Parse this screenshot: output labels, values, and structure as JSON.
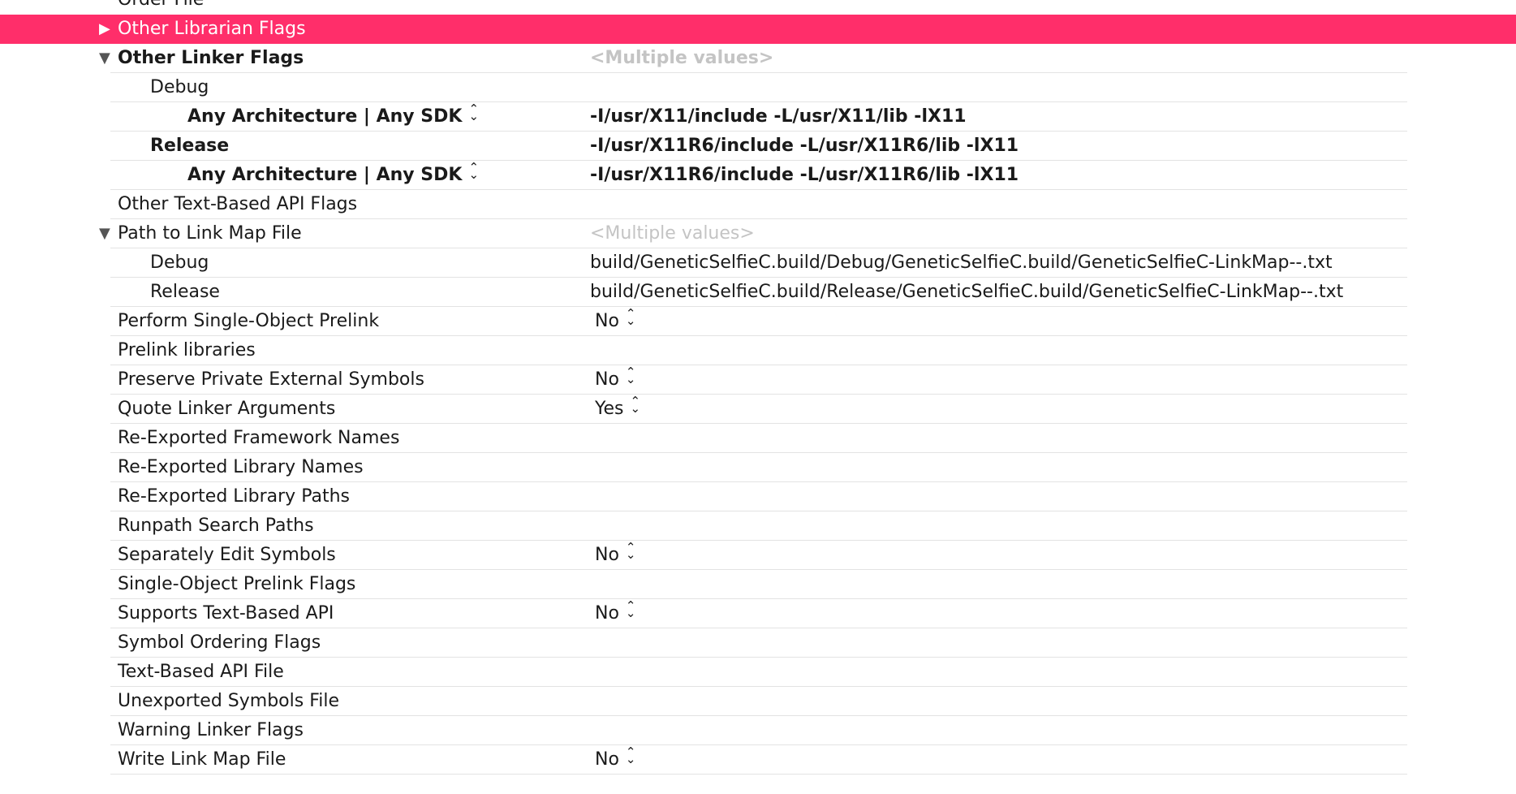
{
  "rows": [
    {
      "label": "Order File",
      "value": ""
    },
    {
      "label": "Other Librarian Flags",
      "value": "",
      "disclosure": "▶"
    },
    {
      "label": "Other Linker Flags",
      "value": "<Multiple values>",
      "disclosure": "▼"
    },
    {
      "label": "Debug",
      "value": ""
    },
    {
      "label": "Any Architecture | Any SDK",
      "value": "-I/usr/X11/include -L/usr/X11/lib -lX11"
    },
    {
      "label": "Release",
      "value": "-I/usr/X11R6/include -L/usr/X11R6/lib -lX11"
    },
    {
      "label": "Any Architecture | Any SDK",
      "value": "-I/usr/X11R6/include -L/usr/X11R6/lib -lX11"
    },
    {
      "label": "Other Text-Based API Flags",
      "value": ""
    },
    {
      "label": "Path to Link Map File",
      "value": "<Multiple values>",
      "disclosure": "▼"
    },
    {
      "label": "Debug",
      "value": "build/GeneticSelfieC.build/Debug/GeneticSelfieC.build/GeneticSelfieC-LinkMap--.txt"
    },
    {
      "label": "Release",
      "value": "build/GeneticSelfieC.build/Release/GeneticSelfieC.build/GeneticSelfieC-LinkMap--.txt"
    },
    {
      "label": "Perform Single-Object Prelink",
      "value": "No"
    },
    {
      "label": "Prelink libraries",
      "value": ""
    },
    {
      "label": "Preserve Private External Symbols",
      "value": "No"
    },
    {
      "label": "Quote Linker Arguments",
      "value": "Yes"
    },
    {
      "label": "Re-Exported Framework Names",
      "value": ""
    },
    {
      "label": "Re-Exported Library Names",
      "value": ""
    },
    {
      "label": "Re-Exported Library Paths",
      "value": ""
    },
    {
      "label": "Runpath Search Paths",
      "value": ""
    },
    {
      "label": "Separately Edit Symbols",
      "value": "No"
    },
    {
      "label": "Single-Object Prelink Flags",
      "value": ""
    },
    {
      "label": "Supports Text-Based API",
      "value": "No"
    },
    {
      "label": "Symbol Ordering Flags",
      "value": ""
    },
    {
      "label": "Text-Based API File",
      "value": ""
    },
    {
      "label": "Unexported Symbols File",
      "value": ""
    },
    {
      "label": "Warning Linker Flags",
      "value": ""
    },
    {
      "label": "Write Link Map File",
      "value": "No"
    }
  ],
  "colors": {
    "selection": "#ff2e6a",
    "placeholder": "#c4c4c4",
    "separator": "#e3e3e3"
  },
  "icons": {
    "collapsed": "disclosure-collapsed-icon",
    "expanded": "disclosure-expanded-icon",
    "stepper": "stepper-updown-icon"
  }
}
